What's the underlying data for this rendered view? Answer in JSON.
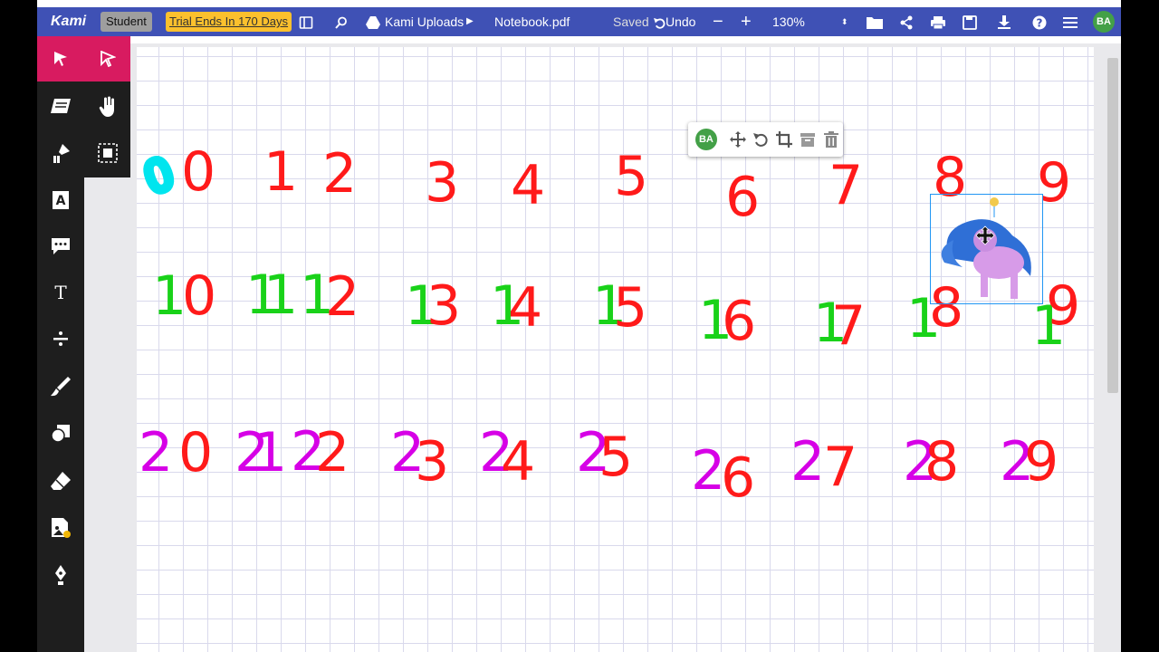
{
  "navbar": {
    "brand": "Kami",
    "role_badge": "Student",
    "trial_badge": "Trial Ends In 170 Days",
    "breadcrumb": "Kami Uploads",
    "filename": "Notebook.pdf",
    "save_status": "Saved",
    "undo_label": "Undo",
    "zoom_out": "−",
    "zoom_in": "+",
    "zoom_value": "130%",
    "user_initials": "BA",
    "icons": [
      "sidebar-toggle-icon",
      "search-icon",
      "drive-icon",
      "caret-right-icon",
      "undo-icon",
      "folder-icon",
      "share-icon",
      "print-icon",
      "save-icon",
      "download-icon",
      "help-icon",
      "menu-icon"
    ]
  },
  "sidebar": {
    "tools": [
      "select",
      "select-alt",
      "dictionary",
      "pan",
      "text-highlight",
      "capture",
      "text-box",
      "comment",
      "text",
      "equation",
      "drawing",
      "shapes",
      "eraser",
      "add-media",
      "signature"
    ]
  },
  "float_toolbar": {
    "user_initials": "BA",
    "actions": [
      "move",
      "rotate",
      "crop",
      "archive",
      "delete"
    ]
  },
  "canvas": {
    "row1": [
      {
        "text": "0",
        "color": "#00e5ee"
      },
      {
        "text": "0",
        "color": "#ff1a1a"
      },
      {
        "text": "1",
        "color": "#ff1a1a"
      },
      {
        "text": "2",
        "color": "#ff1a1a"
      },
      {
        "text": "3",
        "color": "#ff1a1a"
      },
      {
        "text": "4",
        "color": "#ff1a1a"
      },
      {
        "text": "5",
        "color": "#ff1a1a"
      },
      {
        "text": "6",
        "color": "#ff1a1a"
      },
      {
        "text": "7",
        "color": "#ff1a1a"
      },
      {
        "text": "8",
        "color": "#ff1a1a"
      },
      {
        "text": "9",
        "color": "#ff1a1a"
      }
    ],
    "row2": [
      {
        "text": "1",
        "color": "#19d219"
      },
      {
        "text": "0",
        "color": "#ff1a1a"
      },
      {
        "text": "1",
        "color": "#19d219"
      },
      {
        "text": "1",
        "color": "#19d219"
      },
      {
        "text": "1",
        "color": "#19d219"
      },
      {
        "text": "2",
        "color": "#ff1a1a"
      },
      {
        "text": "1",
        "color": "#19d219"
      },
      {
        "text": "3",
        "color": "#ff1a1a"
      },
      {
        "text": "1",
        "color": "#19d219"
      },
      {
        "text": "4",
        "color": "#ff1a1a"
      },
      {
        "text": "1",
        "color": "#19d219"
      },
      {
        "text": "5",
        "color": "#ff1a1a"
      },
      {
        "text": "1",
        "color": "#19d219"
      },
      {
        "text": "6",
        "color": "#ff1a1a"
      },
      {
        "text": "1",
        "color": "#19d219"
      },
      {
        "text": "7",
        "color": "#ff1a1a"
      },
      {
        "text": "1",
        "color": "#19d219"
      },
      {
        "text": "8",
        "color": "#ff1a1a"
      },
      {
        "text": "1",
        "color": "#19d219"
      },
      {
        "text": "9",
        "color": "#ff1a1a"
      }
    ],
    "row3": [
      {
        "text": "2",
        "color": "#d600e6"
      },
      {
        "text": "0",
        "color": "#ff1a1a"
      },
      {
        "text": "2",
        "color": "#d600e6"
      },
      {
        "text": "1",
        "color": "#d600e6"
      },
      {
        "text": "2",
        "color": "#d600e6"
      },
      {
        "text": "2",
        "color": "#ff1a1a"
      },
      {
        "text": "2",
        "color": "#d600e6"
      },
      {
        "text": "3",
        "color": "#ff1a1a"
      },
      {
        "text": "2",
        "color": "#d600e6"
      },
      {
        "text": "4",
        "color": "#ff1a1a"
      },
      {
        "text": "2",
        "color": "#d600e6"
      },
      {
        "text": "5",
        "color": "#ff1a1a"
      },
      {
        "text": "2",
        "color": "#d600e6"
      },
      {
        "text": "6",
        "color": "#ff1a1a"
      },
      {
        "text": "2",
        "color": "#d600e6"
      },
      {
        "text": "7",
        "color": "#ff1a1a"
      },
      {
        "text": "2",
        "color": "#d600e6"
      },
      {
        "text": "8",
        "color": "#ff1a1a"
      },
      {
        "text": "2",
        "color": "#d600e6"
      },
      {
        "text": "9",
        "color": "#ff1a1a"
      }
    ]
  },
  "sticker": {
    "name": "pony-sticker",
    "colors": [
      "#2f6fd6",
      "#d79be8",
      "#f2c94c"
    ]
  }
}
